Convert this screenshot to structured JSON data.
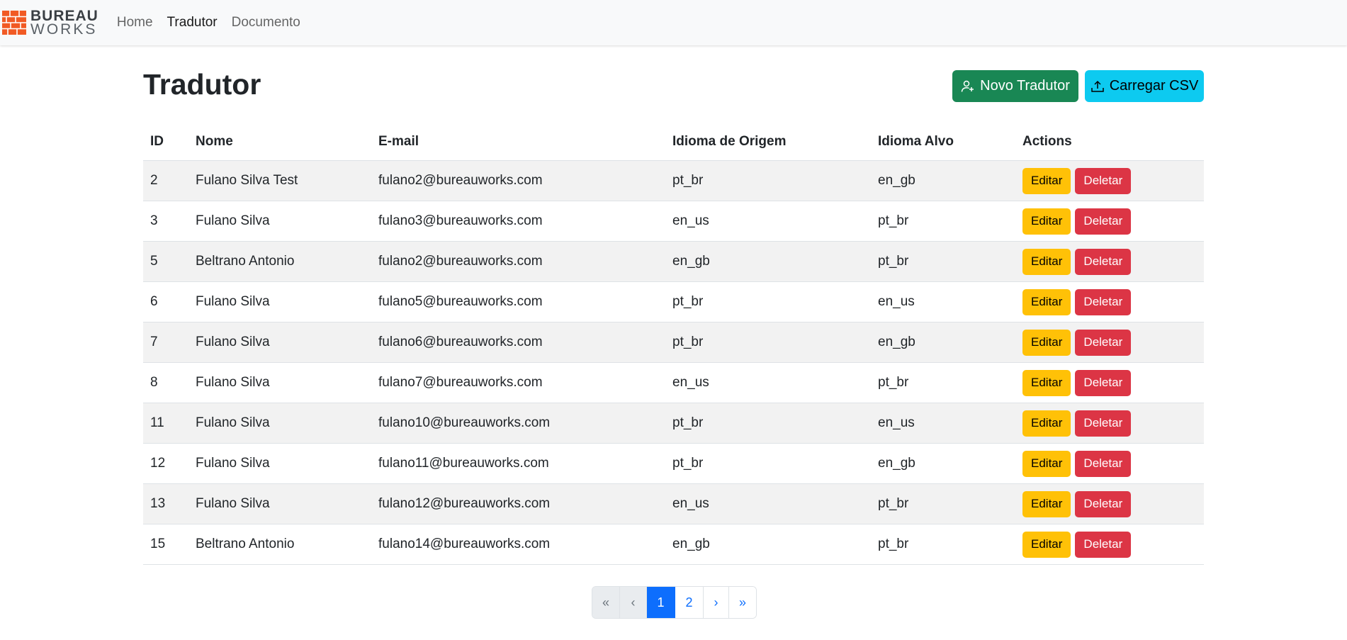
{
  "navbar": {
    "brand_top": "BUREAU",
    "brand_bottom": "WORKS",
    "brand_color": "#f15a24",
    "links": [
      {
        "label": "Home",
        "active": false
      },
      {
        "label": "Tradutor",
        "active": true
      },
      {
        "label": "Documento",
        "active": false
      }
    ]
  },
  "page": {
    "title": "Tradutor",
    "new_button": {
      "label": "Novo Tradutor",
      "icon": "person-add-icon",
      "color": "#198754"
    },
    "csv_button": {
      "label": "Carregar CSV",
      "icon": "upload-icon",
      "color": "#0dcaf0"
    }
  },
  "table": {
    "headers": [
      "ID",
      "Nome",
      "E-mail",
      "Idioma de Origem",
      "Idioma Alvo",
      "Actions"
    ],
    "edit_label": "Editar",
    "delete_label": "Deletar",
    "edit_color": "#ffc107",
    "delete_color": "#dc3545",
    "rows": [
      {
        "id": "2",
        "nome": "Fulano Silva Test",
        "email": "fulano2@bureauworks.com",
        "origem": "pt_br",
        "alvo": "en_gb"
      },
      {
        "id": "3",
        "nome": "Fulano Silva",
        "email": "fulano3@bureauworks.com",
        "origem": "en_us",
        "alvo": "pt_br"
      },
      {
        "id": "5",
        "nome": "Beltrano Antonio",
        "email": "fulano2@bureauworks.com",
        "origem": "en_gb",
        "alvo": "pt_br"
      },
      {
        "id": "6",
        "nome": "Fulano Silva",
        "email": "fulano5@bureauworks.com",
        "origem": "pt_br",
        "alvo": "en_us"
      },
      {
        "id": "7",
        "nome": "Fulano Silva",
        "email": "fulano6@bureauworks.com",
        "origem": "pt_br",
        "alvo": "en_gb"
      },
      {
        "id": "8",
        "nome": "Fulano Silva",
        "email": "fulano7@bureauworks.com",
        "origem": "en_us",
        "alvo": "pt_br"
      },
      {
        "id": "11",
        "nome": "Fulano Silva",
        "email": "fulano10@bureauworks.com",
        "origem": "pt_br",
        "alvo": "en_us"
      },
      {
        "id": "12",
        "nome": "Fulano Silva",
        "email": "fulano11@bureauworks.com",
        "origem": "pt_br",
        "alvo": "en_gb"
      },
      {
        "id": "13",
        "nome": "Fulano Silva",
        "email": "fulano12@bureauworks.com",
        "origem": "en_us",
        "alvo": "pt_br"
      },
      {
        "id": "15",
        "nome": "Beltrano Antonio",
        "email": "fulano14@bureauworks.com",
        "origem": "en_gb",
        "alvo": "pt_br"
      }
    ]
  },
  "pagination": {
    "first": "«",
    "prev": "‹",
    "pages": [
      "1",
      "2"
    ],
    "current_page": 1,
    "next": "›",
    "last": "»",
    "active_color": "#0d6efd"
  }
}
